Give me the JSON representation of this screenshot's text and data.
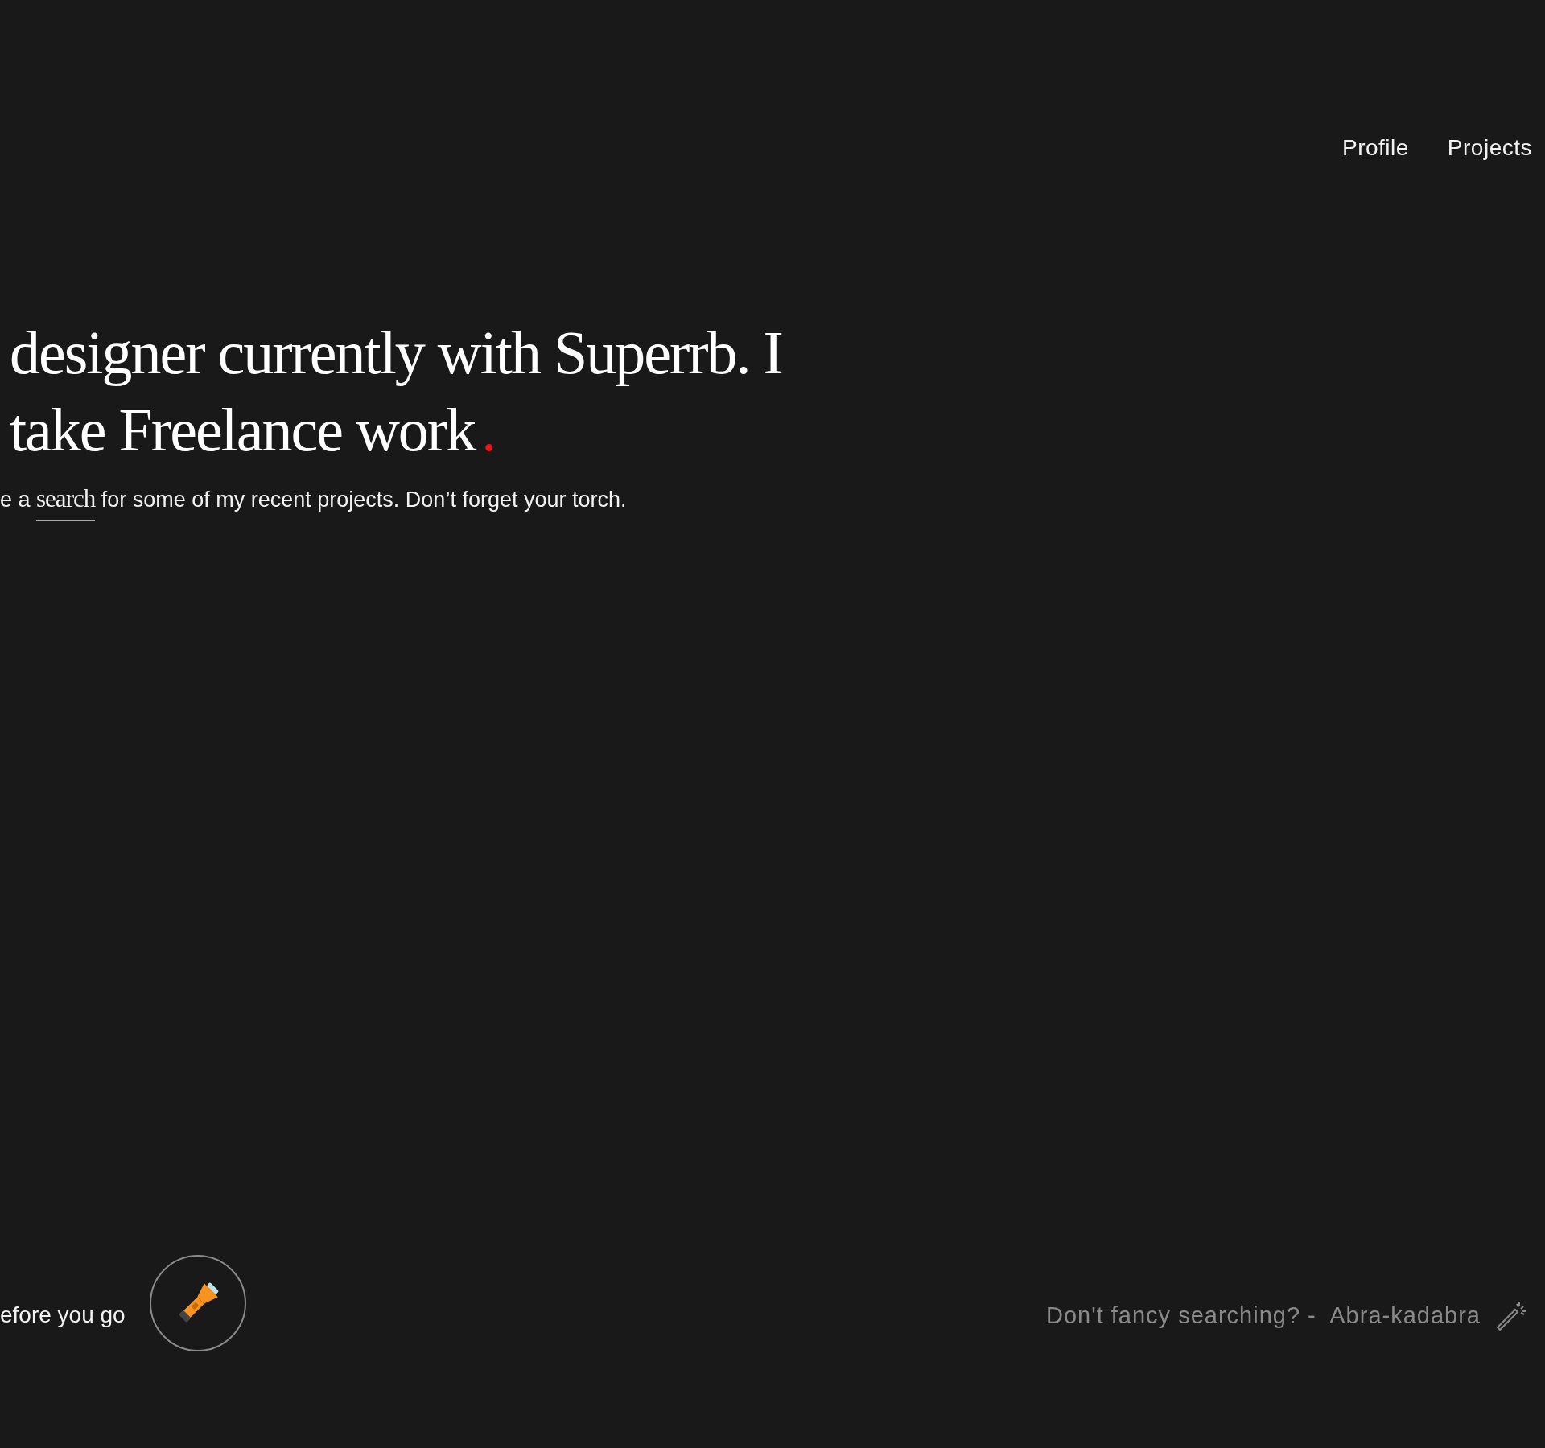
{
  "nav": [
    {
      "label": "Profile"
    },
    {
      "label": "Projects"
    }
  ],
  "heading": {
    "lines": [
      "designer currently with Superrb. I",
      "take Freelance work"
    ],
    "accent": "."
  },
  "intro": {
    "before": "e a",
    "link": "search",
    "after": "for some of my recent projects. Don’t forget your torch."
  },
  "footer": {
    "prompt": "efore you go",
    "shortcut": "Don't fancy searching? -  Abra-kadabra"
  }
}
